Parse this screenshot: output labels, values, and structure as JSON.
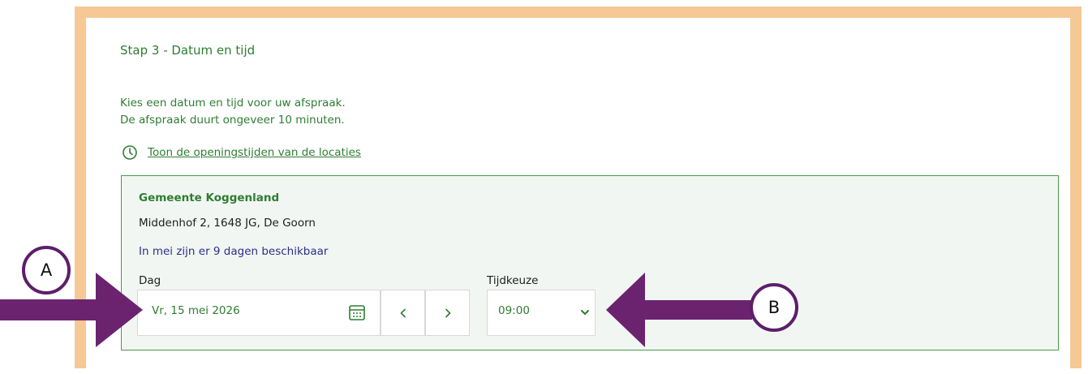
{
  "step": {
    "title": "Stap 3 - Datum en tijd"
  },
  "intro": {
    "line1": "Kies een datum en tijd voor uw afspraak.",
    "line2": "De afspraak duurt ongeveer 10 minuten."
  },
  "opening_hours": {
    "link_label": "Toon de openingstijden van de locaties",
    "icon": "clock-icon"
  },
  "location": {
    "name": "Gemeente Koggenland",
    "address": "Middenhof 2, 1648 JG, De Goorn",
    "availability": "In mei zijn er 9 dagen beschikbaar"
  },
  "date_picker": {
    "label": "Dag",
    "value": "Vr, 15 mei 2026",
    "icon": "calendar-icon",
    "prev_icon": "chevron-left-icon",
    "next_icon": "chevron-right-icon"
  },
  "time_picker": {
    "label": "Tijdkeuze",
    "selected": "09:00",
    "icon": "chevron-down-icon"
  },
  "annotations": {
    "badge_a": "A",
    "badge_b": "B"
  },
  "colors": {
    "accent_green": "#2e7d32",
    "link_blue": "#2c2f8a",
    "frame_orange": "#f5c894",
    "arrow_purple": "#6b2370",
    "card_bg": "#f2f6f2"
  }
}
